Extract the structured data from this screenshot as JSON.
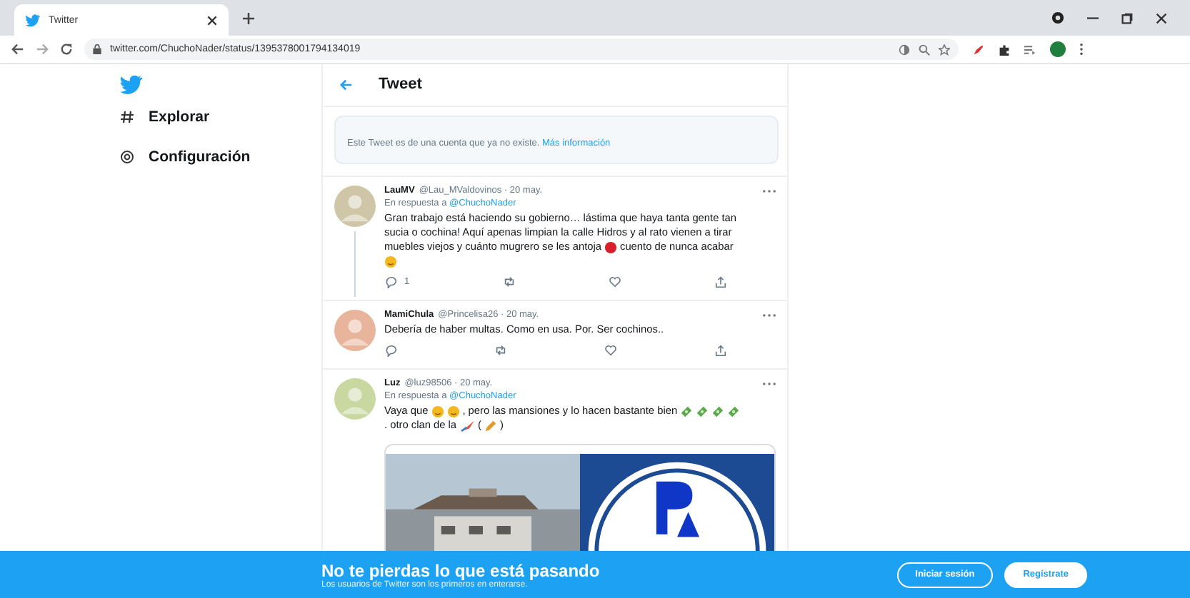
{
  "browser": {
    "tab": {
      "title": "Twitter"
    },
    "url": "twitter.com/ChuchoNader/status/1395378001794134019"
  },
  "nav": [
    {
      "label": "Explorar",
      "kind": "hash"
    },
    {
      "label": "Configuración",
      "kind": "gear"
    }
  ],
  "header": {
    "title": "Tweet"
  },
  "notice": {
    "text": "Este Tweet es de una cuenta que ya no existe.",
    "link": "Más información"
  },
  "tweets": [
    {
      "name": "LauMV",
      "handle": "@Lau_MValdovinos · 20 may.",
      "reply_label": "En respuesta a",
      "reply_to": "@ChuchoNader",
      "thread": true,
      "media": false,
      "replies": "1",
      "body": [
        [
          {
            "kind": "text",
            "text": "Gran trabajo está haciendo su gobierno… lástima que haya tanta gente tan"
          }
        ],
        [
          {
            "kind": "text",
            "text": "sucia o cochina!  Aquí apenas limpian la calle Hidros y al rato vienen a tirar"
          }
        ],
        [
          {
            "kind": "text",
            "text": "muebles viejos y cuánto mugrero se les antoja"
          },
          {
            "kind": "dot"
          },
          {
            "kind": "text",
            "text": "cuento de nunca acabar"
          }
        ],
        [
          {
            "kind": "face"
          }
        ]
      ]
    },
    {
      "name": "MamiChula",
      "handle": "@Princelisa26 · 20 may.",
      "thread": false,
      "media": false,
      "body": [
        [
          {
            "kind": "text",
            "text": "Debería de haber multas. Como en usa. Por. Ser cochinos.."
          }
        ]
      ]
    },
    {
      "name": "Luz",
      "handle": "@luz98506 · 20 may.",
      "reply_label": "En respuesta a",
      "reply_to": "@ChuchoNader",
      "thread": false,
      "media": true,
      "body": [
        [
          {
            "kind": "text",
            "text": "Vaya que"
          },
          {
            "kind": "face"
          },
          {
            "kind": "face"
          },
          {
            "kind": "text",
            "text": ", pero las mansiones y lo hacen bastante bien"
          },
          {
            "kind": "money"
          },
          {
            "kind": "money"
          },
          {
            "kind": "money"
          },
          {
            "kind": "money"
          }
        ],
        [
          {
            "kind": "text",
            "text": ". otro clan de la"
          },
          {
            "kind": "brush"
          },
          {
            "kind": "text",
            "text": "("
          },
          {
            "kind": "pencil"
          },
          {
            "kind": "text",
            "text": ")"
          }
        ]
      ]
    }
  ],
  "banner": {
    "title": "No te pierdas lo que está pasando",
    "subtitle": "Los usuarios de Twitter son los primeros en enterarse.",
    "login": "Iniciar sesión",
    "signup": "Regístrate"
  }
}
